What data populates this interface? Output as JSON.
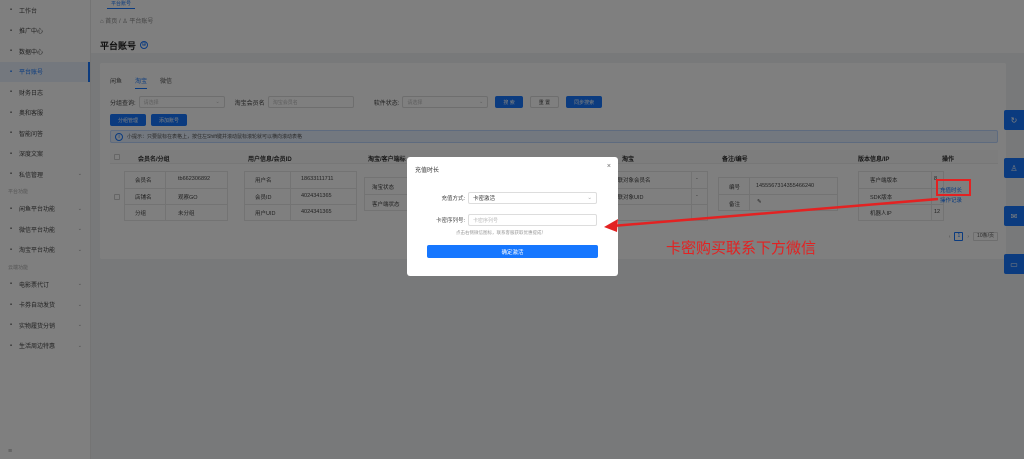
{
  "sidebar": {
    "items_top": [
      {
        "label": "工作台",
        "icon": "grid-icon"
      },
      {
        "label": "推广中心",
        "icon": "send-icon"
      },
      {
        "label": "数据中心",
        "icon": "data-icon"
      },
      {
        "label": "平台账号",
        "icon": "user-icon",
        "active": true
      },
      {
        "label": "财务日志",
        "icon": "finance-icon"
      },
      {
        "label": "奥和客服",
        "icon": "service-icon"
      },
      {
        "label": "智能问答",
        "icon": "qa-icon"
      },
      {
        "label": "深度文案",
        "icon": "doc-icon"
      },
      {
        "label": "私信管理",
        "icon": "message-icon",
        "chevron": true
      }
    ],
    "group1": "平台功能",
    "items_mid": [
      {
        "label": "闲鱼平台功能",
        "icon": "fish-icon"
      },
      {
        "label": "微信平台功能",
        "icon": "wechat-icon"
      },
      {
        "label": "淘宝平台功能",
        "icon": "taobao-icon"
      }
    ],
    "group2": "云端功能",
    "items_bottom": [
      {
        "label": "电影票代订",
        "icon": "ticket-icon"
      },
      {
        "label": "卡券自动发货",
        "icon": "card-icon"
      },
      {
        "label": "实物履货分销",
        "icon": "box-icon"
      },
      {
        "label": "生活周边特惠",
        "icon": "life-icon"
      }
    ],
    "footer_icon": "≡"
  },
  "topbar": {
    "tab": "平台账号"
  },
  "page": {
    "breadcrumb": "⌂ 首页 / ♙ 平台账号",
    "title": "平台账号",
    "title_icon": "⊕"
  },
  "tabs": [
    "闲鱼",
    "淘宝",
    "微信"
  ],
  "filters": {
    "group_label": "分组查询:",
    "group_placeholder": "请选择",
    "member_label": "淘宝会员名",
    "member_placeholder": "淘宝会员名",
    "status_label": "软件状态:",
    "status_placeholder": "请选择",
    "search": "搜 索",
    "reset": "重 置",
    "sync": "同步搜索"
  },
  "actions": {
    "group_manage": "分组管理",
    "add_account": "添加账号"
  },
  "tip": "小提示：只要鼠标在表格上，按住左Shift键并滚动鼠标滚轮就可以横向滚动表格",
  "table": {
    "headers": [
      "会员名/分组",
      "用户信息/会员ID",
      "淘宝/客户端标",
      "淘宝",
      "备注/编号",
      "版本信息/IP",
      "操作"
    ],
    "row": {
      "member_fields": [
        [
          "会员名",
          "tb662306892"
        ],
        [
          "店铺名",
          "观察GO"
        ],
        [
          "分组",
          "未分组"
        ]
      ],
      "user_fields": [
        [
          "用户名",
          "18633111711"
        ],
        [
          "会员ID",
          "4024341365"
        ],
        [
          "用户UID",
          "4024341365"
        ]
      ],
      "client_fields": [
        "淘宝状态",
        "客户端状态"
      ],
      "binding_fields": [
        [
          "关联对象会员名",
          "-"
        ],
        [
          "关联对象UID",
          "-"
        ],
        [
          "ID",
          ""
        ]
      ],
      "remark_fields": [
        [
          "编号",
          "1455567314355466240"
        ],
        [
          "备注",
          "✎"
        ]
      ],
      "version_fields": [
        [
          "客户端版本",
          "8"
        ],
        [
          "SDK版本",
          ""
        ],
        [
          "机器人IP",
          "12"
        ]
      ],
      "ops": [
        "充值时长",
        "操作记录"
      ]
    }
  },
  "pager": {
    "prev": "‹",
    "page": "1",
    "next": "›",
    "size": "10条/页"
  },
  "modal": {
    "title": "充值时长",
    "close": "×",
    "method_label": "充值方式:",
    "method_value": "卡密激活",
    "serial_label": "卡密序列号:",
    "serial_placeholder": "卡密序列号",
    "hint": "点击右侧微信图标，联系客服获取优惠提成！",
    "confirm": "确定激活"
  },
  "annotation": {
    "text": "卡密购买联系下方微信",
    "color": "#e32222"
  },
  "right_float_icons": [
    "refresh-icon",
    "shirt-icon",
    "wechat-icon",
    "video-icon"
  ],
  "colors": {
    "primary": "#1677ff",
    "annotation_red": "#e32222"
  }
}
